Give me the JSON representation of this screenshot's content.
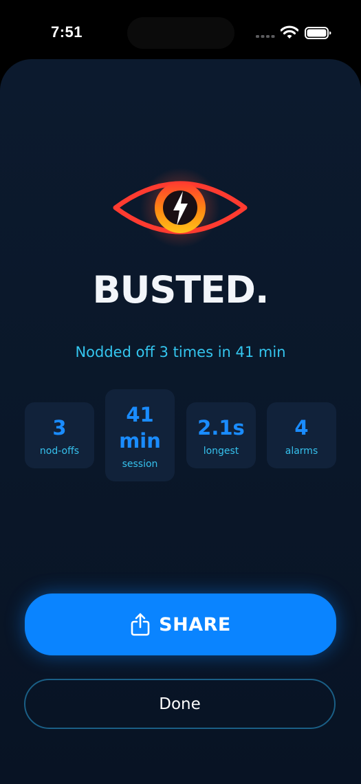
{
  "status_bar": {
    "time": "7:51",
    "icons": [
      "cellular-signal-icon",
      "wifi-icon",
      "battery-icon"
    ]
  },
  "hero": {
    "icon": "eye-lightning-icon",
    "title": "BUSTED.",
    "subtitle": "Nodded off 3 times in 41 min"
  },
  "stats": [
    {
      "value": "3",
      "label": "nod-offs"
    },
    {
      "value": "41 min",
      "label": "session"
    },
    {
      "value": "2.1s",
      "label": "longest"
    },
    {
      "value": "4",
      "label": "alarms"
    }
  ],
  "actions": {
    "share_label": "SHARE",
    "share_icon": "share-icon",
    "done_label": "Done"
  },
  "colors": {
    "background": "#0a1729",
    "accent_blue": "#0a84ff",
    "subtitle_cyan": "#34c6ef",
    "eye_red": "#ff3b30",
    "eye_amber": "#ffb000"
  }
}
